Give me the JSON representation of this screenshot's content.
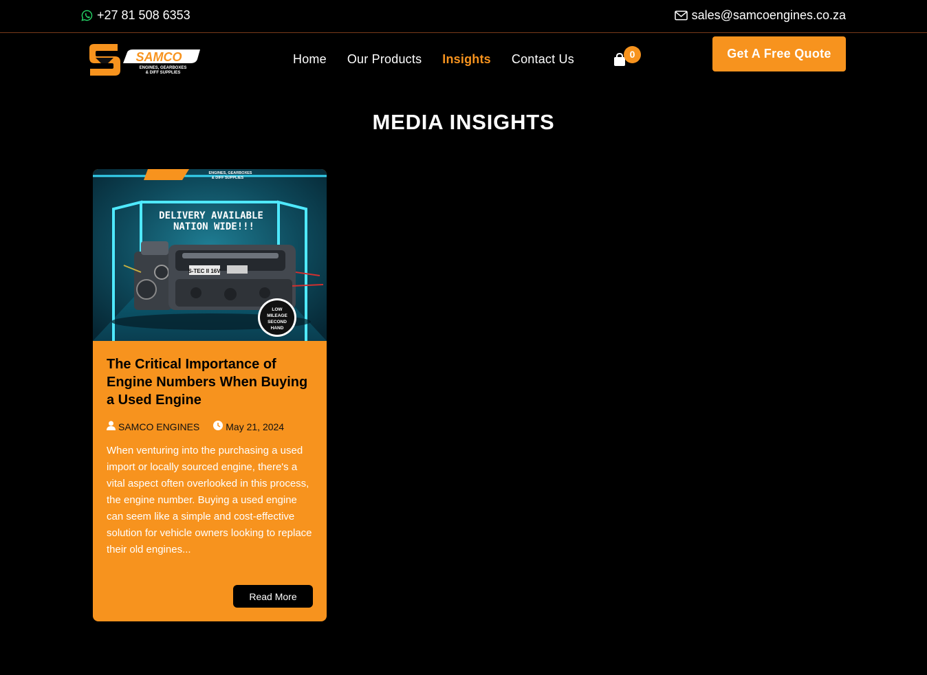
{
  "topbar": {
    "phone": "+27 81 508 6353",
    "email": "sales@samcoengines.co.za"
  },
  "logo": {
    "name": "SAMCO",
    "tagline_1": "ENGINES, GEARBOXES",
    "tagline_2": "& DIFF SUPPLIES"
  },
  "nav": {
    "items": [
      {
        "label": "Home"
      },
      {
        "label": "Our Products"
      },
      {
        "label": "Insights"
      },
      {
        "label": "Contact Us"
      }
    ],
    "active": "Insights",
    "cart_count": "0"
  },
  "header": {
    "quote_button": "Get A Free Quote"
  },
  "page": {
    "title": "MEDIA INSIGHTS"
  },
  "posts": [
    {
      "image": {
        "brand_1": "ENGINES, GEARBOXES",
        "brand_2": "& DIFF SUPPLIES",
        "headline_1": "DELIVERY AVAILABLE",
        "headline_2": "NATION WIDE!!!",
        "engine_label": "S-TEC II 16V",
        "badge_1": "LOW",
        "badge_2": "MILEAGE",
        "badge_3": "SECOND",
        "badge_4": "HAND"
      },
      "title": "The Critical Importance of Engine Numbers When Buying a Used Engine",
      "author": "SAMCO ENGINES",
      "date": "May 21, 2024",
      "excerpt": "When venturing into the purchasing a used import or locally sourced engine, there's a vital aspect often overlooked in this process, the engine number. Buying a used engine can seem like a simple and cost-effective solution for vehicle owners looking to replace their old engines...",
      "read_more": "Read More"
    }
  ],
  "colors": {
    "accent": "#f7931e",
    "background": "#000000",
    "whatsapp": "#25d366"
  }
}
